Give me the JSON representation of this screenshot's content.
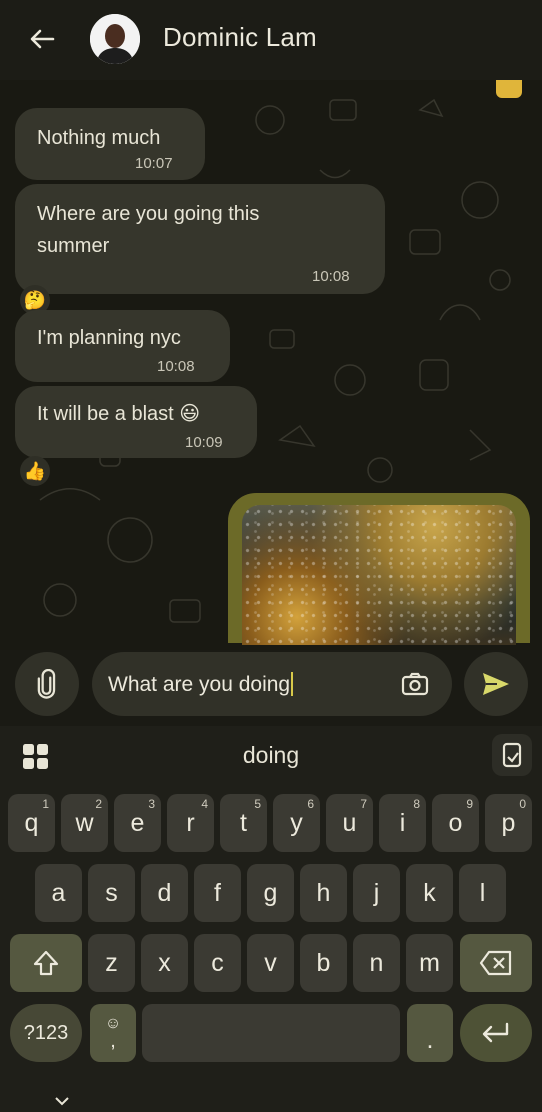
{
  "header": {
    "back_icon": "arrow-left-icon",
    "contact_name": "Dominic Lam"
  },
  "messages": [
    {
      "text": "Nothing much",
      "time": "10:07",
      "direction": "incoming"
    },
    {
      "text": "Where are you going this summer",
      "line1": "Where are you going this",
      "line2": "summer",
      "time": "10:08",
      "direction": "incoming",
      "reaction": "🤔"
    },
    {
      "text": "I'm planning nyc",
      "time": "10:08",
      "direction": "incoming"
    },
    {
      "text": "It will be a blast 😃",
      "time": "10:09",
      "direction": "incoming",
      "reaction": "👍"
    }
  ],
  "outgoing_image": {
    "description_icon": "photo-thumbnail"
  },
  "composer": {
    "value": "What are you doing",
    "attach_icon": "paperclip-icon",
    "camera_icon": "camera-icon",
    "send_icon": "send-icon"
  },
  "keyboard": {
    "suggestion": "doing",
    "row1": [
      {
        "k": "q",
        "h": "1"
      },
      {
        "k": "w",
        "h": "2"
      },
      {
        "k": "e",
        "h": "3"
      },
      {
        "k": "r",
        "h": "4"
      },
      {
        "k": "t",
        "h": "5"
      },
      {
        "k": "y",
        "h": "6"
      },
      {
        "k": "u",
        "h": "7"
      },
      {
        "k": "i",
        "h": "8"
      },
      {
        "k": "o",
        "h": "9"
      },
      {
        "k": "p",
        "h": "0"
      }
    ],
    "row2": [
      "a",
      "s",
      "d",
      "f",
      "g",
      "h",
      "j",
      "k",
      "l"
    ],
    "row3": [
      "z",
      "x",
      "c",
      "v",
      "b",
      "n",
      "m"
    ],
    "sym_label": "?123",
    "comma_label": ",",
    "period_label": ".",
    "colors": {
      "key": "#3b3a33",
      "modifier": "#555840",
      "background": "#1f1f19"
    }
  },
  "colors": {
    "chat_bg": "#191912",
    "bubble_in": "#36362c",
    "image_frame": "#6c6a28",
    "send_accent": "#d8d86a"
  }
}
